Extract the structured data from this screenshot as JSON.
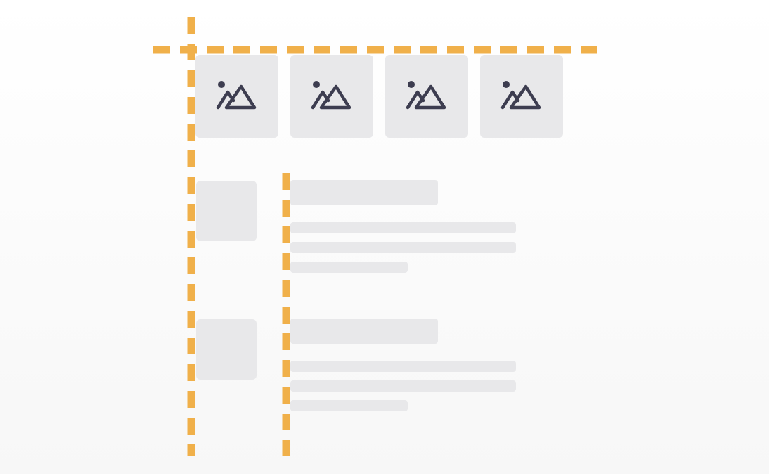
{
  "colors": {
    "guide": "#f0b04a",
    "placeholder": "#e8e8ea",
    "icon": "#3d3d50",
    "background": "#fafafa"
  },
  "gallery": {
    "tiles": [
      {
        "icon": "image-icon"
      },
      {
        "icon": "image-icon"
      },
      {
        "icon": "image-icon"
      },
      {
        "icon": "image-icon"
      }
    ]
  },
  "list": {
    "items": [
      {
        "thumbnail": "placeholder",
        "lines": [
          "title",
          "line",
          "line",
          "short-line"
        ]
      },
      {
        "thumbnail": "placeholder",
        "lines": [
          "title",
          "line",
          "line",
          "short-line"
        ]
      }
    ]
  },
  "guides": [
    {
      "orientation": "horizontal",
      "style": "dashed"
    },
    {
      "orientation": "vertical",
      "style": "dashed"
    },
    {
      "orientation": "vertical",
      "style": "dashed"
    }
  ]
}
